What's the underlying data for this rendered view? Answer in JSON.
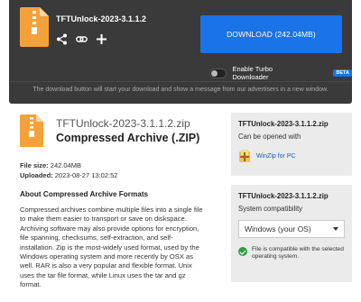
{
  "top": {
    "filename": "TFTUnlock-2023-3.1.1.2",
    "download_label": "DOWNLOAD (242.04MB)",
    "turbo_label": "Enable Turbo Downloader",
    "beta_badge": "BETA",
    "notice": "The download button will start your download and show a message from our advertisers in a new window.",
    "share_icons": [
      "share-icon",
      "link-icon",
      "plus-icon"
    ],
    "accent": "#1a73e8",
    "file_icon_color": "#f5a13a"
  },
  "file": {
    "name": "TFTUnlock-2023-3.1.1.2.zip",
    "type": "Compressed Archive (.ZIP)",
    "size_label": "File size:",
    "size": "242.04MB",
    "uploaded_label": "Uploaded:",
    "uploaded": "2023-08-27 13:02:52"
  },
  "about": {
    "heading": "About Compressed Archive Formats",
    "body": "Compressed archives combine multiple files into a single file to make them easier to transport or save on diskspace. Archiving software may also provide options for encryption, file spanning, checksums, self-extraction, and self-installation. Zip is the most-widely used format, used by the Windows operating system and more recently by OSX as well. RAR is also a very popular and flexible format. Unix uses the tar file format, while Linux uses the tar and gz format."
  },
  "open_with": {
    "title": "TFTUnlock-2023-3.1.1.2.zip",
    "subtitle": "Can be opened with",
    "app": "WinZip for PC"
  },
  "compat": {
    "title": "TFTUnlock-2023-3.1.1.2.zip",
    "subtitle": "System compatibility",
    "selected": "Windows (your OS)",
    "status": "File is compatible with the selected operating system.",
    "status_color": "#2e9e3f"
  }
}
